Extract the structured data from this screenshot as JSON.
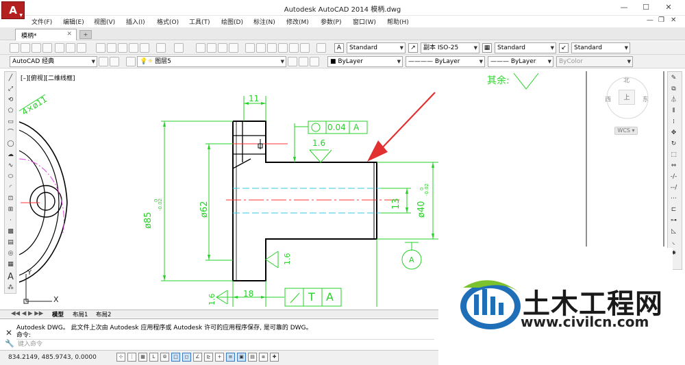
{
  "window": {
    "title": "Autodesk AutoCAD 2014    模柄.dwg",
    "app_button": "A",
    "minimize": "—",
    "maximize": "☐",
    "close": "✕",
    "mdi_min": "—",
    "mdi_restore": "❐",
    "mdi_close": "✕"
  },
  "menu": [
    "文件(F)",
    "编辑(E)",
    "视图(V)",
    "插入(I)",
    "格式(O)",
    "工具(T)",
    "绘图(D)",
    "标注(N)",
    "修改(M)",
    "参数(P)",
    "窗口(W)",
    "帮助(H)"
  ],
  "tabs": {
    "doc": "模柄*",
    "close": "✕",
    "new": "+"
  },
  "toolbar": {
    "text_style": "Standard",
    "dim_style": "副本 ISO-25",
    "table_style": "Standard",
    "multileader_style": "Standard",
    "workspace": "AutoCAD 经典",
    "layer": "图层5",
    "color": "ByLayer",
    "linetype": "ByLayer",
    "lineweight": "ByLayer",
    "plotstyle": "ByColor"
  },
  "viewport": {
    "label": "[–][俯视][二维线框]"
  },
  "viewcube": {
    "north": "北",
    "west": "西",
    "east": "东",
    "top": "上",
    "wcs": "WCS ▾"
  },
  "drawing": {
    "roughness_other": "其余:",
    "dim_11": "11",
    "dim_phi85": "ø85",
    "dim_phi85_tol_up": "0",
    "dim_phi85_tol_low": "-0.02",
    "dim_phi62": "ø62",
    "dim_13": "13",
    "dim_phi40": "ø40",
    "dim_phi40_tol_up": "0",
    "dim_phi40_tol_low": "-0.02",
    "dim_18": "18",
    "dim_phi11": "4×ø11",
    "roughness_16_top": "1.6",
    "roughness_16_mid": "1.6",
    "roughness_16_left": "1.6",
    "tol_value": "0.04",
    "tol_datum": "A",
    "runout_t": "T",
    "runout_a": "A",
    "datum_a": "A",
    "axis_x": "X",
    "axis_y": "Y"
  },
  "layout_tabs": [
    "模型",
    "布局1",
    "布局2"
  ],
  "command": {
    "line1": "Autodesk DWG。  此文件上次由 Autodesk 应用程序或 Autodesk 许可的应用程序保存, 是可靠的 DWG。",
    "line2": "命令:",
    "placeholder": "键入命令"
  },
  "status": {
    "coords": "834.2149,  485.9743,  0.0000"
  },
  "watermark": {
    "title": "土木工程网",
    "url": "www.civilcn.com"
  },
  "colors": {
    "dim_green": "#26d126",
    "arrow_red": "#e23030",
    "center_red": "#ff3030",
    "hidden_cyan": "#30c8e0",
    "phantom_magenta": "#e040e0"
  }
}
